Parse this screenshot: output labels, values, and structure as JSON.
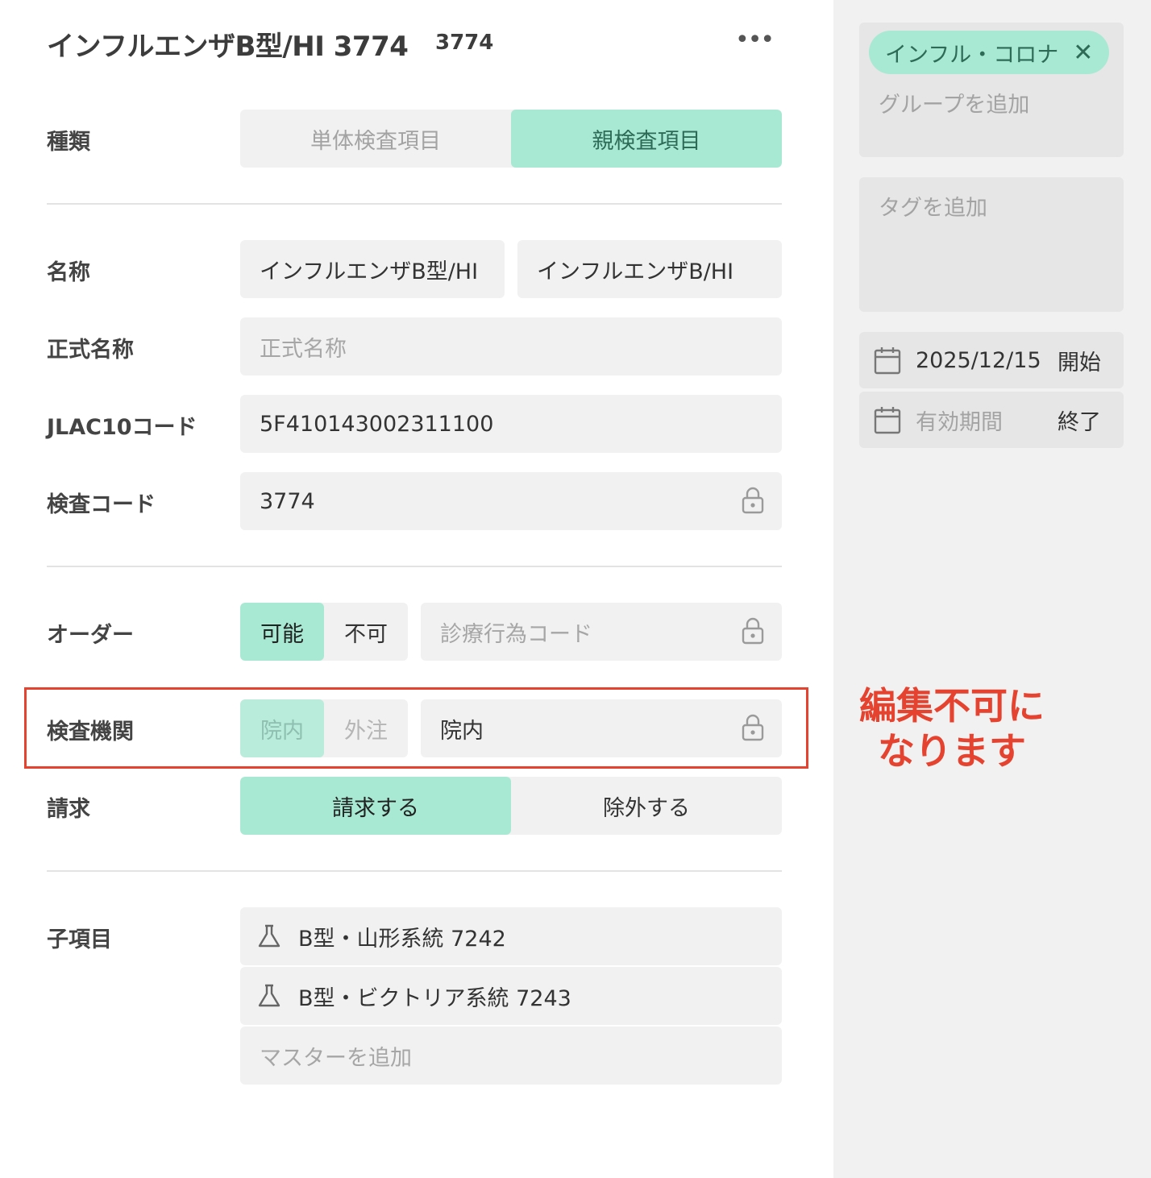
{
  "header": {
    "title": "インフルエンザB型/HI 3774",
    "code": "3774",
    "more": "•••"
  },
  "type_row": {
    "label": "種類",
    "options": [
      "単体検査項目",
      "親検査項目"
    ],
    "selected": "親検査項目"
  },
  "name_row": {
    "label": "名称",
    "value1": "インフルエンザB型/HI",
    "value2": "インフルエンザB/HI"
  },
  "formal_name_row": {
    "label": "正式名称",
    "placeholder": "正式名称"
  },
  "jlac_row": {
    "label": "JLAC10コード",
    "value": "5F410143002311100"
  },
  "test_code_row": {
    "label": "検査コード",
    "value": "3774"
  },
  "order_row": {
    "label": "オーダー",
    "options": [
      "可能",
      "不可"
    ],
    "selected": "可能",
    "code_placeholder": "診療行為コード"
  },
  "lab_row": {
    "label": "検査機関",
    "options": [
      "院内",
      "外注"
    ],
    "selected": "院内",
    "value": "院内"
  },
  "billing_row": {
    "label": "請求",
    "options": [
      "請求する",
      "除外する"
    ],
    "selected": "請求する"
  },
  "children": {
    "label": "子項目",
    "items": [
      "B型・山形系統 7242",
      "B型・ビクトリア系統 7243"
    ],
    "add_placeholder": "マスターを追加"
  },
  "callout": {
    "line1": "編集不可に",
    "line2": "なります",
    "color": "#e5432f"
  },
  "sidebar": {
    "group_chip": "インフル・コロナ",
    "group_chip_close": "✕",
    "group_placeholder": "グループを追加",
    "tag_placeholder": "タグを追加",
    "start_date": "2025/12/15",
    "start_label": "開始",
    "end_placeholder": "有効期間",
    "end_label": "終了"
  },
  "colors": {
    "accent": "#a8e9d4",
    "accent_text": "#2d6b57",
    "field_bg": "#f1f1f1",
    "sidebar_bg": "#f1f1f1"
  },
  "icons": {
    "lock": "lock-icon",
    "calendar": "calendar-icon",
    "flask": "flask-icon",
    "more": "more-icon",
    "close": "close-icon"
  }
}
